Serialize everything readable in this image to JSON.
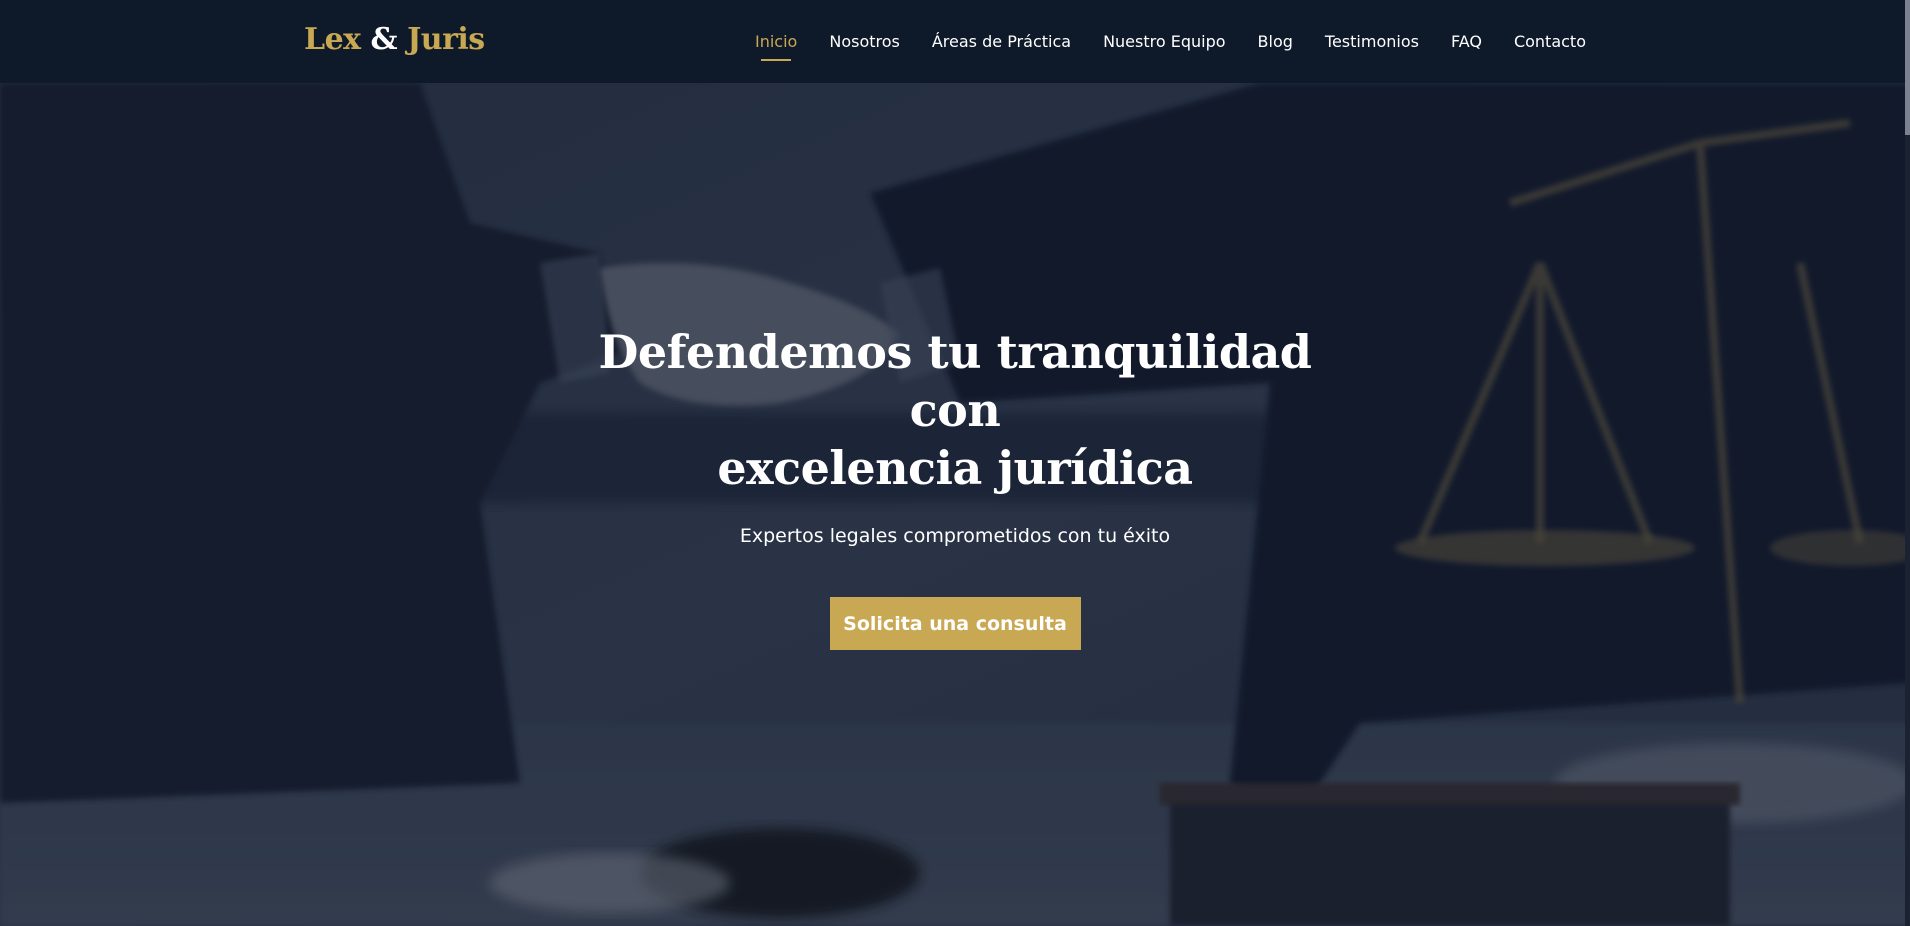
{
  "brand": {
    "logo_part1": "Lex",
    "logo_amp": "&",
    "logo_part2": "Juris"
  },
  "nav": {
    "items": [
      {
        "label": "Inicio",
        "active": true
      },
      {
        "label": "Nosotros",
        "active": false
      },
      {
        "label": "Áreas de Práctica",
        "active": false
      },
      {
        "label": "Nuestro Equipo",
        "active": false
      },
      {
        "label": "Blog",
        "active": false
      },
      {
        "label": "Testimonios",
        "active": false
      },
      {
        "label": "FAQ",
        "active": false
      },
      {
        "label": "Contacto",
        "active": false
      }
    ]
  },
  "hero": {
    "title_line1": "Defendemos tu tranquilidad con",
    "title_line2": "excelencia jurídica",
    "subtitle": "Expertos legales comprometidos con tu éxito",
    "cta_label": "Solicita una consulta",
    "background_image": "handshake-with-scales-of-justice"
  },
  "colors": {
    "navbar_bg": "#0e192a",
    "accent_gold": "#c9a854",
    "text_white": "#ffffff",
    "hero_overlay": "#0e182a"
  }
}
